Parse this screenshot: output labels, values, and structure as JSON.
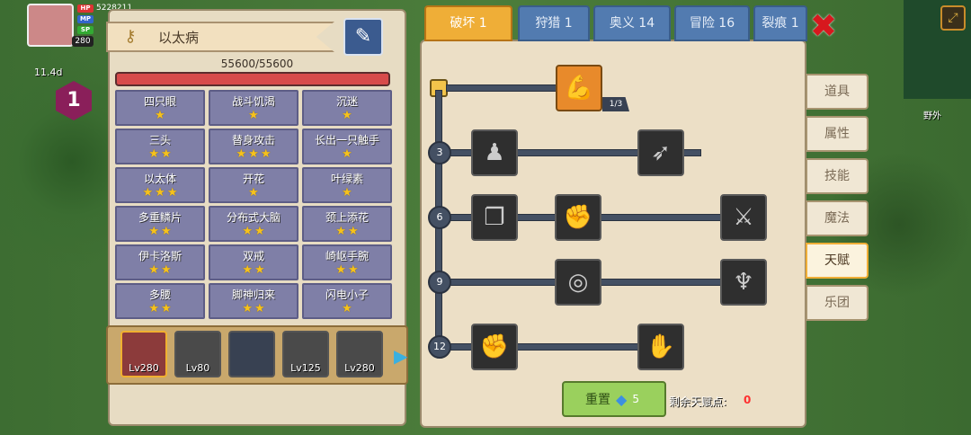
{
  "hud": {
    "hp_label": "HP",
    "mp_label": "MP",
    "sp_label": "SP",
    "hp_value": "5228211",
    "level": "280",
    "timer": "11.4d",
    "badge_number": "1"
  },
  "character_panel": {
    "name": "以太病",
    "hp_text": "55600/55600",
    "hp_fraction": 1.0,
    "traits": [
      {
        "name": "四只眼",
        "stars": 1
      },
      {
        "name": "战斗饥渴",
        "stars": 1
      },
      {
        "name": "沉迷",
        "stars": 1
      },
      {
        "name": "三头",
        "stars": 2
      },
      {
        "name": "替身攻击",
        "stars": 3
      },
      {
        "name": "长出一只触手",
        "stars": 1
      },
      {
        "name": "以太体",
        "stars": 3
      },
      {
        "name": "开花",
        "stars": 1
      },
      {
        "name": "叶绿素",
        "stars": 1
      },
      {
        "name": "多重鳞片",
        "stars": 2
      },
      {
        "name": "分布式大脑",
        "stars": 2
      },
      {
        "name": "颈上添花",
        "stars": 2
      },
      {
        "name": "伊卡洛斯",
        "stars": 2
      },
      {
        "name": "双戒",
        "stars": 2
      },
      {
        "name": "崎岖手腕",
        "stars": 2
      },
      {
        "name": "多腰",
        "stars": 2
      },
      {
        "name": "脚神归来",
        "stars": 2
      },
      {
        "name": "闪电小子",
        "stars": 1
      }
    ],
    "party": [
      {
        "level": "Lv280",
        "selected": true
      },
      {
        "level": "Lv80",
        "selected": false
      },
      {
        "level": "",
        "selected": false
      },
      {
        "level": "Lv125",
        "selected": false
      },
      {
        "level": "Lv280",
        "selected": false
      }
    ]
  },
  "tabs": [
    {
      "label": "破坏 1",
      "active": true
    },
    {
      "label": "狩猎 1",
      "active": false
    },
    {
      "label": "奥义 14",
      "active": false
    },
    {
      "label": "冒险 16",
      "active": false
    },
    {
      "label": "裂痕 1",
      "active": false
    }
  ],
  "talent_tree": {
    "rows": [
      {
        "level": "",
        "nodes": [
          {
            "icon": "arm-wrestle-icon",
            "active": true,
            "count": "1/3"
          }
        ]
      },
      {
        "level": "3",
        "nodes": [
          {
            "icon": "body-icon"
          },
          {
            "icon": "arrow-icon"
          }
        ]
      },
      {
        "level": "6",
        "nodes": [
          {
            "icon": "scroll-icon"
          },
          {
            "icon": "punch-icon"
          },
          {
            "icon": "sword-icon"
          }
        ]
      },
      {
        "level": "9",
        "nodes": [
          {
            "icon": "vortex-icon"
          },
          {
            "icon": "bat-icon"
          }
        ]
      },
      {
        "level": "12",
        "nodes": [
          {
            "icon": "fist-icon"
          },
          {
            "icon": "gauntlet-icon"
          }
        ]
      }
    ],
    "reset_label": "重置",
    "reset_cost": "5",
    "points_label": "剩余天赋点:",
    "points_value": "0"
  },
  "side_menu": [
    {
      "label": "道具",
      "active": false
    },
    {
      "label": "属性",
      "active": false
    },
    {
      "label": "技能",
      "active": false
    },
    {
      "label": "魔法",
      "active": false
    },
    {
      "label": "天赋",
      "active": true
    },
    {
      "label": "乐团",
      "active": false
    }
  ],
  "map": {
    "area_label": "野外"
  },
  "colors": {
    "accent": "#efae37",
    "tab_blue": "#527bb0",
    "hp_red": "#d74b4b",
    "points_red": "#ff3030"
  }
}
